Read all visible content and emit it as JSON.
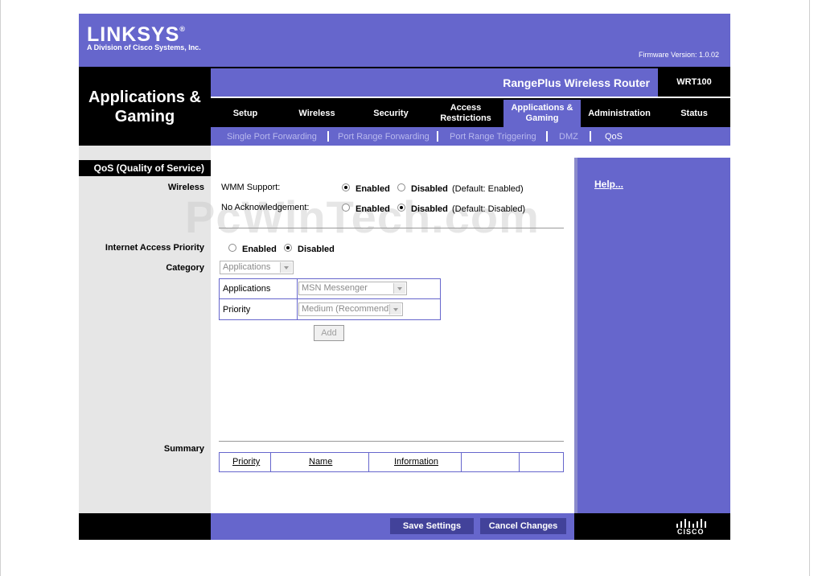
{
  "brand": {
    "logo": "LINKSYS",
    "logo_mark": "®",
    "tagline": "A Division of Cisco Systems, Inc.",
    "firmware": "Firmware Version: 1.0.02"
  },
  "product": {
    "name": "RangePlus Wireless Router",
    "model": "WRT100"
  },
  "section_title": "Applications & Gaming",
  "tabs": [
    {
      "label": "Setup"
    },
    {
      "label": "Wireless"
    },
    {
      "label": "Security"
    },
    {
      "label": "Access Restrictions"
    },
    {
      "label": "Applications & Gaming",
      "active": true
    },
    {
      "label": "Administration"
    },
    {
      "label": "Status"
    }
  ],
  "subtabs": [
    {
      "label": "Single Port Forwarding"
    },
    {
      "label": "Port Range Forwarding"
    },
    {
      "label": "Port Range Triggering"
    },
    {
      "label": "DMZ"
    },
    {
      "label": "QoS",
      "active": true
    }
  ],
  "left_labels": {
    "header": "QoS (Quality of Service)",
    "wireless": "Wireless",
    "internet_access_priority": "Internet Access Priority",
    "category": "Category",
    "summary": "Summary"
  },
  "wireless": {
    "wmm_label": "WMM Support:",
    "wmm_enabled": "Enabled",
    "wmm_disabled": "Disabled",
    "wmm_default": "(Default: Enabled)",
    "wmm_value": "Enabled",
    "noack_label": "No Acknowledgement:",
    "noack_enabled": "Enabled",
    "noack_disabled": "Disabled",
    "noack_default": "(Default: Disabled)",
    "noack_value": "Disabled"
  },
  "internet_priority": {
    "enabled": "Enabled",
    "disabled": "Disabled",
    "value": "Disabled"
  },
  "category": {
    "selected": "Applications"
  },
  "app_table": {
    "applications_label": "Applications",
    "applications_value": "MSN Messenger",
    "priority_label": "Priority",
    "priority_value": "Medium (Recommend)"
  },
  "add_button": "Add",
  "summary_table": {
    "columns": [
      "Priority",
      "Name",
      "Information",
      "",
      ""
    ]
  },
  "help_link": "Help...",
  "footer": {
    "save": "Save Settings",
    "cancel": "Cancel Changes",
    "cisco": "CISCO"
  },
  "watermark": "PcWinTech.com",
  "colors": {
    "brand": "#6666cc",
    "dark": "#000000",
    "button": "#42429a"
  }
}
